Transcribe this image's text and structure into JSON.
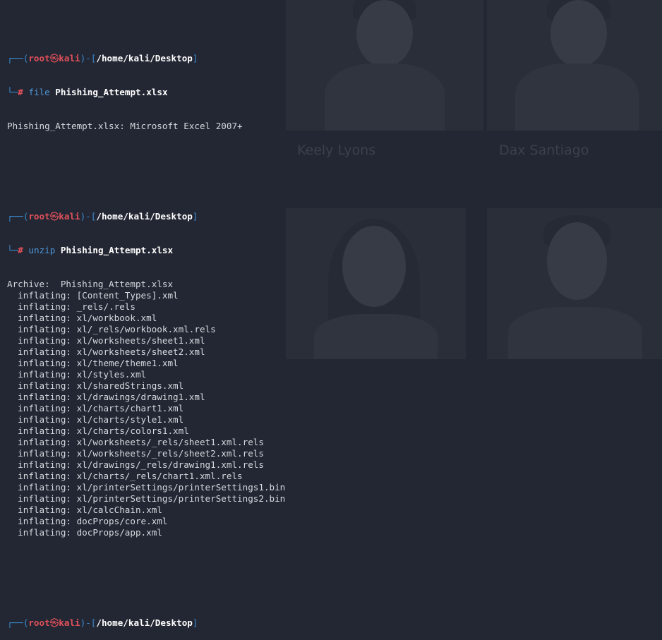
{
  "prompt": {
    "user": "root",
    "skull": "㉿",
    "host": "kali",
    "path": "/home/kali/Desktop",
    "symbol": "#"
  },
  "commands": [
    {
      "cmd": "file",
      "arg": "Phishing_Attempt.xlsx",
      "output": [
        "Phishing_Attempt.xlsx: Microsoft Excel 2007+"
      ]
    },
    {
      "cmd": "unzip",
      "arg": "Phishing_Attempt.xlsx",
      "output": [
        "Archive:  Phishing_Attempt.xlsx",
        "  inflating: [Content_Types].xml",
        "  inflating: _rels/.rels",
        "  inflating: xl/workbook.xml",
        "  inflating: xl/_rels/workbook.xml.rels",
        "  inflating: xl/worksheets/sheet1.xml",
        "  inflating: xl/worksheets/sheet2.xml",
        "  inflating: xl/theme/theme1.xml",
        "  inflating: xl/styles.xml",
        "  inflating: xl/sharedStrings.xml",
        "  inflating: xl/drawings/drawing1.xml",
        "  inflating: xl/charts/chart1.xml",
        "  inflating: xl/charts/style1.xml",
        "  inflating: xl/charts/colors1.xml",
        "  inflating: xl/worksheets/_rels/sheet1.xml.rels",
        "  inflating: xl/worksheets/_rels/sheet2.xml.rels",
        "  inflating: xl/drawings/_rels/drawing1.xml.rels",
        "  inflating: xl/charts/_rels/chart1.xml.rels",
        "  inflating: xl/printerSettings/printerSettings1.bin",
        "  inflating: xl/printerSettings/printerSettings2.bin",
        "  inflating: xl/calcChain.xml",
        "  inflating: docProps/core.xml",
        "  inflating: docProps/app.xml"
      ]
    }
  ],
  "background": {
    "names": [
      "Keely Lyons",
      "Dax Santiago"
    ]
  }
}
